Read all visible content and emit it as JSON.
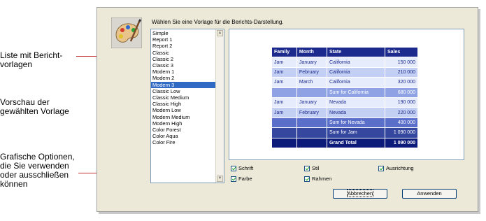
{
  "annotations": {
    "list_label": [
      "Liste mit Bericht-",
      "vorlagen"
    ],
    "preview_label": [
      "Vorschau der",
      "gewählten Vorlage"
    ],
    "options_label": [
      "Grafische Optionen,",
      "die Sie verwenden",
      "oder ausschließen",
      "können"
    ]
  },
  "dialog": {
    "prompt": "Wählen Sie eine Vorlage für die Berichts-Darstellung.",
    "icon": "palette-icon",
    "templates": [
      "Simple",
      "Report 1",
      "Report 2",
      "Classic",
      "Classic 2",
      "Classic 3",
      "Modern 1",
      "Modern 2",
      "Modern 3",
      "Classic Low",
      "Classic Medium",
      "Classic High",
      "Modern Low",
      "Modern Medium",
      "Modern High",
      "Color Forest",
      "Color Aqua",
      "Color Fire"
    ],
    "selected_template": "Modern 3",
    "preview_table": {
      "headers": [
        "Family",
        "Month",
        "State",
        "Sales"
      ],
      "rows": [
        {
          "cells": [
            "Jam",
            "January",
            "California",
            "150 000"
          ],
          "kind": "light"
        },
        {
          "cells": [
            "Jam",
            "February",
            "California",
            "210 000"
          ],
          "kind": "mid"
        },
        {
          "cells": [
            "Jam",
            "March",
            "California",
            "320 000"
          ],
          "kind": "light"
        },
        {
          "cells": [
            "",
            "",
            "Sum for California",
            "680 000"
          ],
          "kind": "sum"
        },
        {
          "cells": [
            "Jam",
            "January",
            "Nevada",
            "190 000"
          ],
          "kind": "light"
        },
        {
          "cells": [
            "Jam",
            "February",
            "Nevada",
            "220 000"
          ],
          "kind": "mid"
        },
        {
          "cells": [
            "",
            "",
            "Sum for Nevada",
            "400 000"
          ],
          "kind": "sum2"
        },
        {
          "cells": [
            "",
            "",
            "Sum for Jam",
            "1 090 000"
          ],
          "kind": "sum3"
        },
        {
          "cells": [
            "",
            "",
            "Grand Total",
            "1 090 000"
          ],
          "kind": "total"
        }
      ]
    },
    "options": {
      "schrift": "Schrift",
      "stil": "Stil",
      "ausrichtung": "Ausrichtung",
      "farbe": "Farbe",
      "rahmen": "Rahmen"
    },
    "buttons": {
      "cancel": "Abbrechen",
      "apply": "Anwenden"
    },
    "colors": {
      "header": "#1b2a8c",
      "light": "#e6ecfb",
      "mid": "#c3d0f4",
      "sum": "#8fa3e4",
      "sum2": "#5a6fc9",
      "sum3": "#36479f",
      "total": "#0c1a7a"
    }
  }
}
